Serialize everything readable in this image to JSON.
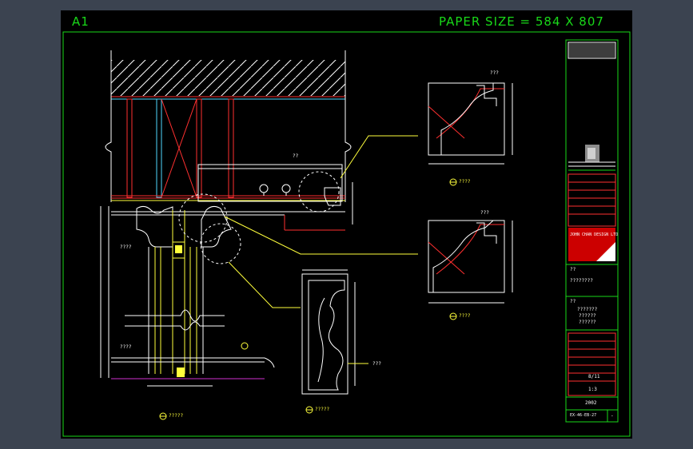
{
  "sheet": {
    "size_label": "A1",
    "paper_label": "PAPER SIZE = 584 X 807"
  },
  "details": {
    "main_caption": "?????",
    "top_section_caption": "????",
    "middle_section_caption": "????",
    "molding_caption": "?????",
    "main_label_a": "????",
    "main_label_b": "????",
    "main_label_top": "??",
    "molding_note": "???",
    "top_section_note": "???",
    "middle_section_note": "???"
  },
  "title_block": {
    "company": "JOHN CHAN DESIGN LTD",
    "note_heading": "??",
    "drawing_title": "????????",
    "sub_heading": "??",
    "sub_lines": [
      "???????",
      "??????",
      "??????"
    ],
    "scale": "8/11",
    "sheet_no": "1:3",
    "date": "2002",
    "drawing_no": "EX-46-EB-27",
    "revision": "-"
  },
  "colors": {
    "sheet_bg": "#000000",
    "outer_bg": "#3b4350",
    "border": "#19d819",
    "line_yellow": "#ffff3c",
    "line_red": "#ff2020",
    "line_white": "#ffffff",
    "line_cyan": "#4fd8ff"
  }
}
